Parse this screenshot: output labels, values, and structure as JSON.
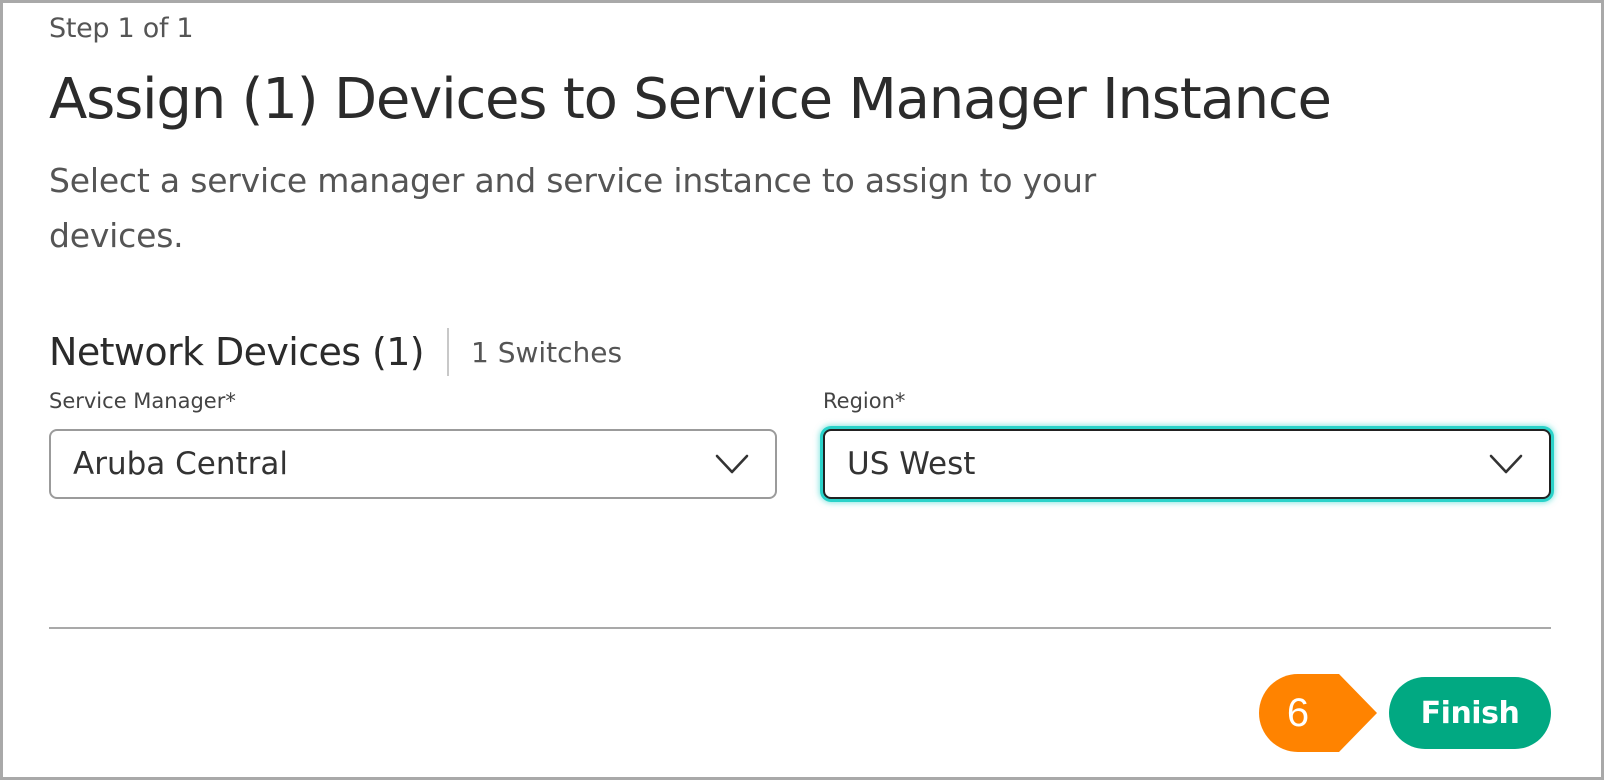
{
  "dialog": {
    "step_label": "Step 1 of 1",
    "title": "Assign (1) Devices to Service Manager Instance",
    "subtitle": "Select a service manager and service instance to assign to your devices."
  },
  "section": {
    "title": "Network Devices (1)",
    "count": "1 Switches"
  },
  "fields": {
    "service_manager": {
      "label": "Service Manager*",
      "value": "Aruba Central"
    },
    "region": {
      "label": "Region*",
      "value": "US West",
      "focused": true
    }
  },
  "footer": {
    "finish_label": "Finish"
  },
  "callout": {
    "number": "6",
    "color": "#ff8300"
  },
  "colors": {
    "accent": "#01a982",
    "focus_ring": "#2ad2c9",
    "text": "#333333"
  },
  "icons": {
    "dropdown": "chevron-down-icon"
  }
}
